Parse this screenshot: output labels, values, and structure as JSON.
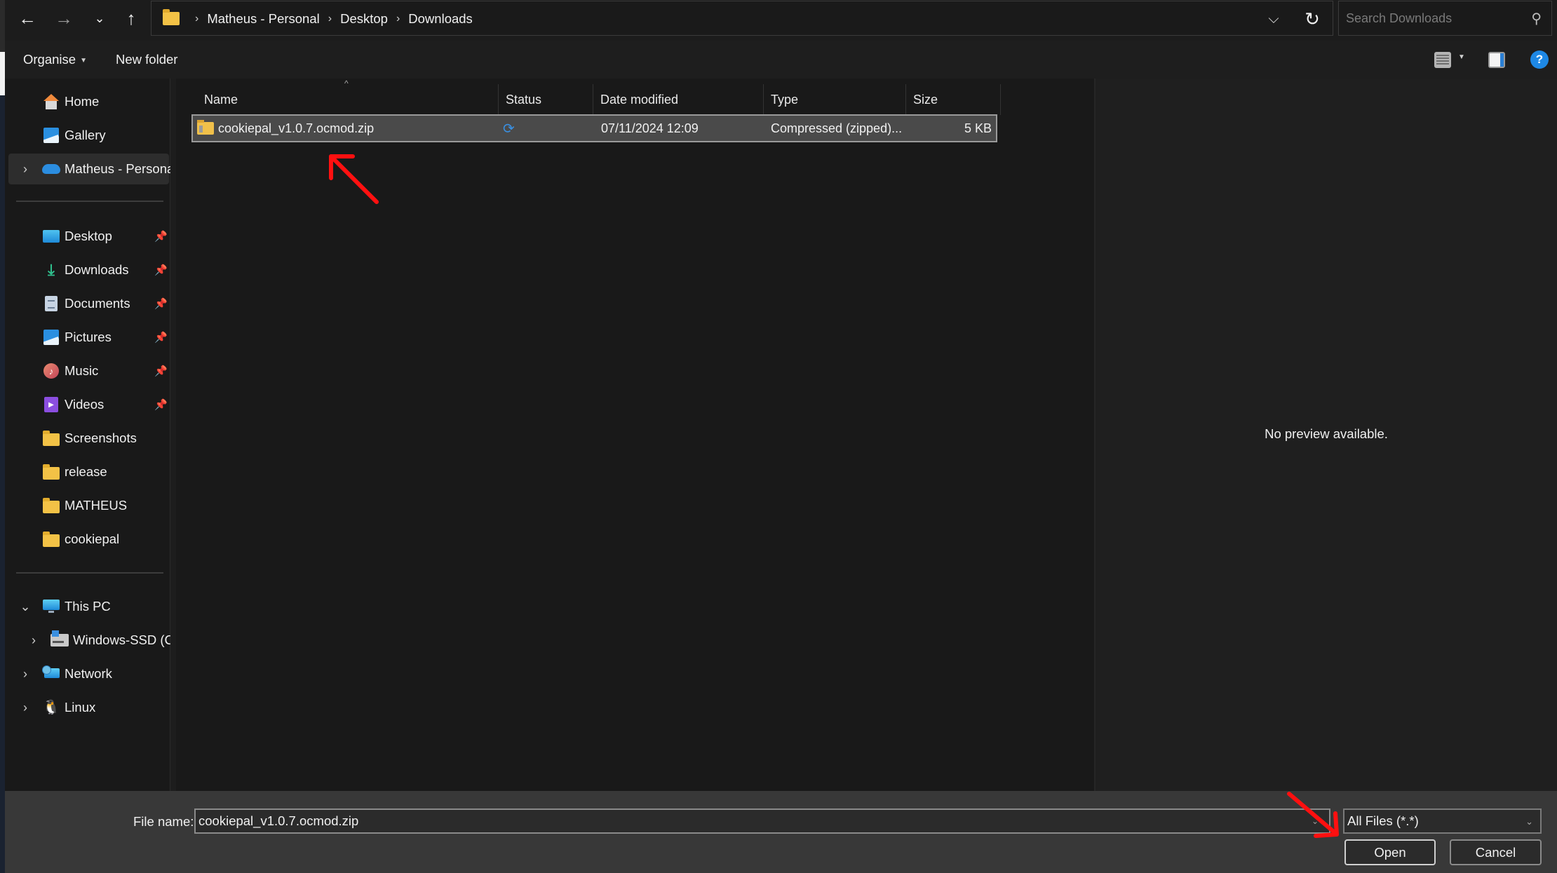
{
  "navigation": {
    "back_icon": "arrow-left",
    "forward_icon": "arrow-right",
    "recent_icon": "chevron-down",
    "up_icon": "arrow-up",
    "breadcrumb": [
      "Matheus - Personal",
      "Desktop",
      "Downloads"
    ],
    "breadcrumb_separator": "›",
    "refresh_icon": "refresh",
    "search_placeholder": "Search Downloads"
  },
  "toolbar": {
    "organise_label": "Organise",
    "new_folder_label": "New folder",
    "help_label": "?"
  },
  "sidebar": {
    "items": [
      {
        "label": "Home",
        "icon": "home"
      },
      {
        "label": "Gallery",
        "icon": "gallery"
      },
      {
        "label": "Matheus - Personal",
        "icon": "onedrive-cloud",
        "expandable": true,
        "selected": true
      },
      {
        "label": "Desktop",
        "icon": "desktop",
        "pinned": true
      },
      {
        "label": "Downloads",
        "icon": "download",
        "pinned": true
      },
      {
        "label": "Documents",
        "icon": "documents",
        "pinned": true
      },
      {
        "label": "Pictures",
        "icon": "pictures",
        "pinned": true
      },
      {
        "label": "Music",
        "icon": "music",
        "pinned": true
      },
      {
        "label": "Videos",
        "icon": "videos",
        "pinned": true
      },
      {
        "label": "Screenshots",
        "icon": "folder"
      },
      {
        "label": "release",
        "icon": "folder"
      },
      {
        "label": "MATHEUS",
        "icon": "folder"
      },
      {
        "label": "cookiepal",
        "icon": "folder"
      },
      {
        "label": "This PC",
        "icon": "this-pc",
        "expanded": true
      },
      {
        "label": "Windows-SSD (C:)",
        "icon": "drive",
        "expandable": true
      },
      {
        "label": "Network",
        "icon": "network",
        "expandable": true
      },
      {
        "label": "Linux",
        "icon": "linux-penguin",
        "expandable": true
      }
    ]
  },
  "file_list": {
    "columns": [
      "Name",
      "Status",
      "Date modified",
      "Type",
      "Size"
    ],
    "sort_indicator": "^",
    "rows": [
      {
        "name": "cookiepal_v1.0.7.ocmod.zip",
        "status_icon": "sync",
        "date_modified": "07/11/2024 12:09",
        "type": "Compressed (zipped)...",
        "size": "5 KB",
        "selected": true
      }
    ]
  },
  "preview": {
    "message": "No preview available."
  },
  "footer": {
    "file_name_label": "File name:",
    "file_name_value": "cookiepal_v1.0.7.ocmod.zip",
    "file_type_filter": "All Files (*.*)",
    "open_label": "Open",
    "cancel_label": "Cancel"
  },
  "annotations": {
    "arrow_color": "#ff1010"
  }
}
